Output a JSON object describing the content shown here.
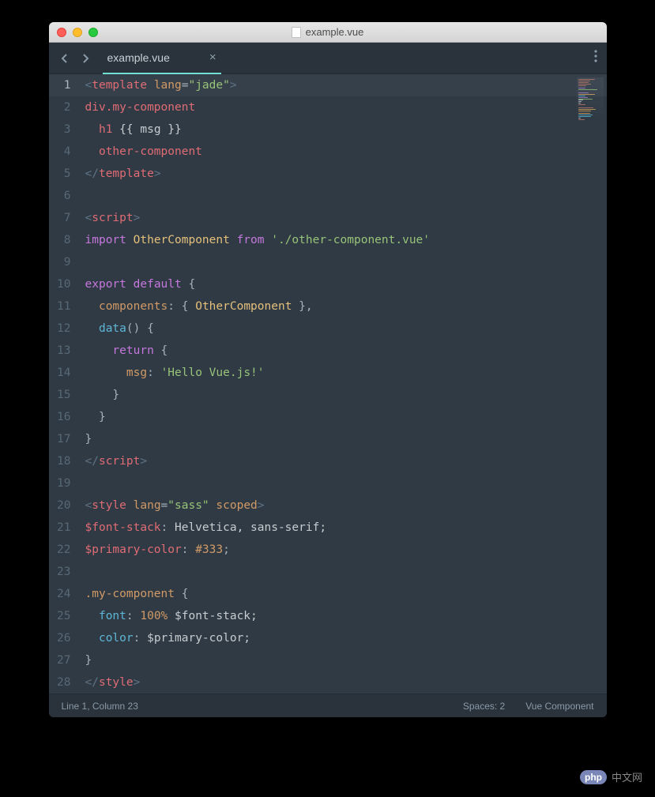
{
  "window": {
    "title": "example.vue"
  },
  "tab": {
    "name": "example.vue"
  },
  "status": {
    "position": "Line 1, Column 23",
    "spaces": "Spaces: 2",
    "language": "Vue Component"
  },
  "watermark": {
    "logo": "php",
    "text": "中文网"
  },
  "code": {
    "lines": [
      {
        "n": 1,
        "active": true,
        "tokens": [
          [
            "<",
            "angle"
          ],
          [
            "template",
            "tag"
          ],
          [
            " ",
            "default"
          ],
          [
            "lang",
            "attr"
          ],
          [
            "=",
            "punct"
          ],
          [
            "\"jade\"",
            "str"
          ],
          [
            ">",
            "angle"
          ]
        ]
      },
      {
        "n": 2,
        "tokens": [
          [
            "div.my-component",
            "tag"
          ]
        ]
      },
      {
        "n": 3,
        "tokens": [
          [
            "  ",
            "default"
          ],
          [
            "h1 ",
            "tag"
          ],
          [
            "{{ msg }}",
            "default"
          ]
        ]
      },
      {
        "n": 4,
        "tokens": [
          [
            "  ",
            "default"
          ],
          [
            "other-component",
            "tag"
          ]
        ]
      },
      {
        "n": 5,
        "tokens": [
          [
            "</",
            "angle"
          ],
          [
            "template",
            "tag"
          ],
          [
            ">",
            "angle"
          ]
        ]
      },
      {
        "n": 6,
        "tokens": []
      },
      {
        "n": 7,
        "tokens": [
          [
            "<",
            "angle"
          ],
          [
            "script",
            "tag"
          ],
          [
            ">",
            "angle"
          ]
        ]
      },
      {
        "n": 8,
        "tokens": [
          [
            "import",
            "kw"
          ],
          [
            " ",
            "default"
          ],
          [
            "OtherComponent",
            "class"
          ],
          [
            " ",
            "default"
          ],
          [
            "from",
            "kw"
          ],
          [
            " ",
            "default"
          ],
          [
            "'./other-component.vue'",
            "str"
          ]
        ]
      },
      {
        "n": 9,
        "tokens": []
      },
      {
        "n": 10,
        "tokens": [
          [
            "export",
            "kw"
          ],
          [
            " ",
            "default"
          ],
          [
            "default",
            "kw"
          ],
          [
            " ",
            "default"
          ],
          [
            "{",
            "punct"
          ]
        ]
      },
      {
        "n": 11,
        "tokens": [
          [
            "  ",
            "default"
          ],
          [
            "components",
            "prop"
          ],
          [
            ":",
            "punct"
          ],
          [
            " { ",
            "punct"
          ],
          [
            "OtherComponent",
            "class"
          ],
          [
            " },",
            "punct"
          ]
        ]
      },
      {
        "n": 12,
        "tokens": [
          [
            "  ",
            "default"
          ],
          [
            "data",
            "func"
          ],
          [
            "()",
            "punct"
          ],
          [
            " ",
            "default"
          ],
          [
            "{",
            "punct"
          ]
        ]
      },
      {
        "n": 13,
        "tokens": [
          [
            "    ",
            "default"
          ],
          [
            "return",
            "kw"
          ],
          [
            " ",
            "default"
          ],
          [
            "{",
            "punct"
          ]
        ]
      },
      {
        "n": 14,
        "tokens": [
          [
            "      ",
            "default"
          ],
          [
            "msg",
            "prop"
          ],
          [
            ":",
            "punct"
          ],
          [
            " ",
            "default"
          ],
          [
            "'Hello Vue.js!'",
            "str"
          ]
        ]
      },
      {
        "n": 15,
        "tokens": [
          [
            "    }",
            "punct"
          ]
        ]
      },
      {
        "n": 16,
        "tokens": [
          [
            "  }",
            "punct"
          ]
        ]
      },
      {
        "n": 17,
        "tokens": [
          [
            "}",
            "punct"
          ]
        ]
      },
      {
        "n": 18,
        "tokens": [
          [
            "</",
            "angle"
          ],
          [
            "script",
            "tag"
          ],
          [
            ">",
            "angle"
          ]
        ]
      },
      {
        "n": 19,
        "tokens": []
      },
      {
        "n": 20,
        "tokens": [
          [
            "<",
            "angle"
          ],
          [
            "style",
            "tag"
          ],
          [
            " ",
            "default"
          ],
          [
            "lang",
            "attr"
          ],
          [
            "=",
            "punct"
          ],
          [
            "\"sass\"",
            "str"
          ],
          [
            " ",
            "default"
          ],
          [
            "scoped",
            "attr"
          ],
          [
            ">",
            "angle"
          ]
        ]
      },
      {
        "n": 21,
        "tokens": [
          [
            "$font-stack",
            "tag"
          ],
          [
            ":",
            "punct"
          ],
          [
            " Helvetica, sans-serif;",
            "default"
          ]
        ]
      },
      {
        "n": 22,
        "tokens": [
          [
            "$primary-color",
            "tag"
          ],
          [
            ":",
            "punct"
          ],
          [
            " ",
            "default"
          ],
          [
            "#333",
            "num"
          ],
          [
            ";",
            "punct"
          ]
        ]
      },
      {
        "n": 23,
        "tokens": []
      },
      {
        "n": 24,
        "tokens": [
          [
            ".my-component",
            "sel"
          ],
          [
            " ",
            "default"
          ],
          [
            "{",
            "punct"
          ]
        ]
      },
      {
        "n": 25,
        "tokens": [
          [
            "  ",
            "default"
          ],
          [
            "font",
            "func"
          ],
          [
            ":",
            "punct"
          ],
          [
            " ",
            "default"
          ],
          [
            "100%",
            "num"
          ],
          [
            " $font-stack;",
            "default"
          ]
        ]
      },
      {
        "n": 26,
        "tokens": [
          [
            "  ",
            "default"
          ],
          [
            "color",
            "func"
          ],
          [
            ":",
            "punct"
          ],
          [
            " $primary-color;",
            "default"
          ]
        ]
      },
      {
        "n": 27,
        "tokens": [
          [
            "}",
            "punct"
          ]
        ]
      },
      {
        "n": 28,
        "tokens": [
          [
            "</",
            "angle"
          ],
          [
            "style",
            "tag"
          ],
          [
            ">",
            "angle"
          ]
        ]
      }
    ]
  }
}
